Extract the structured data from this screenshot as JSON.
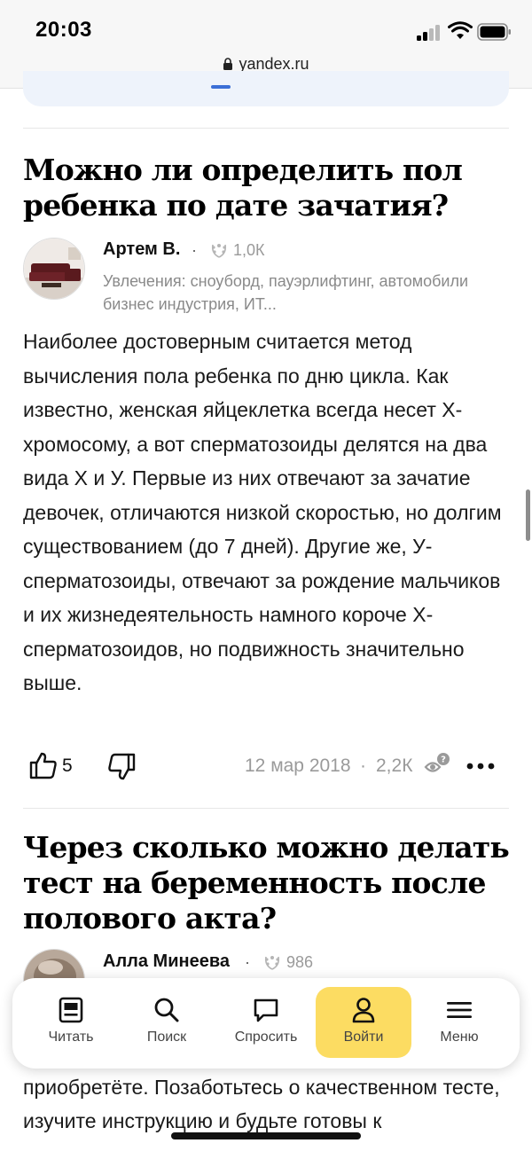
{
  "status_bar": {
    "time": "20:03",
    "url": "yandex.ru"
  },
  "questions": [
    {
      "title": "Можно ли определить пол ребенка по дате зачатия?",
      "author": {
        "name": "Артем В.",
        "rating": "1,0К",
        "bio": "Увлечения: сноуборд, пауэрлифтинг, автомобили бизнес индустрия, ИТ..."
      },
      "answer": "Наиболее достоверным считается метод вычисления пола ребенка по дню цикла. Как известно, женская яйцеклетка всегда несет Х-хромосому, а вот сперматозоиды делятся на два вида Х и У. Первые из них отвечают за зачатие девочек, отличаются низкой скоростью, но долгим существованием (до 7 дней). Другие же, У-сперматозоиды, отвечают за рождение мальчиков и их жизнедеятельность намного короче Х-сперматозоидов, но подвижность значительно выше.",
      "likes": "5",
      "date": "12 мар 2018",
      "views": "2,2К"
    },
    {
      "title": "Через сколько можно делать тест на беременность после полового акта?",
      "author": {
        "name": "Алла Минеева",
        "rating": "986"
      },
      "answer_visible": "приобретёте. Позаботьтесь о качественном тесте, изучите инструкцию и будьте готовы к"
    }
  ],
  "meta_separator": "·",
  "tab_bar": {
    "items": [
      {
        "label": "Читать",
        "icon": "read-icon"
      },
      {
        "label": "Поиск",
        "icon": "search-icon"
      },
      {
        "label": "Спросить",
        "icon": "ask-icon"
      },
      {
        "label": "Войти",
        "icon": "user-icon",
        "active": true
      },
      {
        "label": "Меню",
        "icon": "menu-icon"
      }
    ]
  },
  "colors": {
    "active_tab": "#fcdc62",
    "muted_text": "#9a9a9a",
    "top_card": "#eef3fb"
  }
}
